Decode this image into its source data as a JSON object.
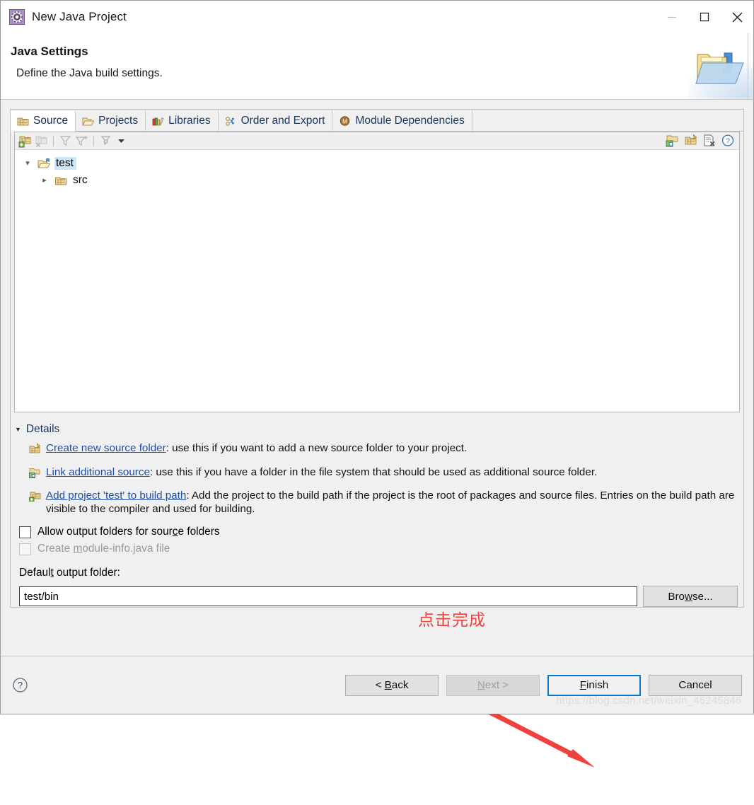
{
  "window": {
    "title": "New Java Project",
    "icon": "java-project-icon",
    "controls": {
      "minimize": "minimize-icon",
      "maximize": "maximize-icon",
      "close": "close-icon"
    }
  },
  "header": {
    "title": "Java Settings",
    "subtitle": "Define the Java build settings.",
    "banner_icon": "java-folder-banner-icon"
  },
  "tabs": [
    {
      "label": "Source",
      "icon": "source-folder-icon",
      "active": true
    },
    {
      "label": "Projects",
      "icon": "open-folder-icon",
      "active": false
    },
    {
      "label": "Libraries",
      "icon": "library-books-icon",
      "active": false
    },
    {
      "label": "Order and Export",
      "icon": "order-export-icon",
      "active": false
    },
    {
      "label": "Module Dependencies",
      "icon": "module-icon",
      "active": false
    }
  ],
  "tree_toolbar": {
    "left_icons": [
      "add-source-folder-icon",
      "remove-source-folder-icon",
      "filter-icon",
      "add-filter-icon",
      "collapse-icon",
      "dropdown-arrow-icon"
    ],
    "right_icons": [
      "link-source-icon",
      "new-folder-icon",
      "remove-entry-icon",
      "help-icon"
    ]
  },
  "tree": {
    "nodes": [
      {
        "label": "test",
        "icon": "project-folder-icon",
        "expanded": true,
        "selected": true,
        "level": 0
      },
      {
        "label": "src",
        "icon": "source-package-icon",
        "expanded": false,
        "selected": false,
        "level": 1
      }
    ]
  },
  "details": {
    "section_label": "Details",
    "expanded": true,
    "items": [
      {
        "icon": "create-source-folder-icon",
        "link": "Create new source folder",
        "rest": ": use this if you want to add a new source folder to your project."
      },
      {
        "icon": "link-source-icon",
        "link": "Link additional source",
        "rest": ": use this if you have a folder in the file system that should be used as additional source folder."
      },
      {
        "icon": "add-project-build-path-icon",
        "link": "Add project 'test' to build path",
        "rest": ": Add the project to the build path if the project is the root of packages and source files. Entries on the build path are visible to the compiler and used for building."
      }
    ]
  },
  "options": {
    "allow_output_folders": {
      "label_pre": "Allow output folders for sour",
      "label_mnemonic": "c",
      "label_post": "e folders",
      "checked": false,
      "enabled": true
    },
    "create_module_info": {
      "label_pre": "Create ",
      "label_mnemonic": "m",
      "label_post": "odule-info.java file",
      "checked": false,
      "enabled": false
    }
  },
  "output_folder": {
    "label_pre": "Defaul",
    "label_mnemonic": "t",
    "label_post": " output folder:",
    "value": "test/bin",
    "browse_pre": "Bro",
    "browse_mnemonic": "w",
    "browse_post": "se..."
  },
  "annotation": {
    "text": "点击完成",
    "color": "#f0413c",
    "arrow": "red-arrow-pointing-to-finish"
  },
  "footer": {
    "help_icon": "help-question-icon",
    "buttons": [
      {
        "name": "back",
        "pre": "< ",
        "mnemonic": "B",
        "post": "ack",
        "state": "enabled"
      },
      {
        "name": "next",
        "pre": "",
        "mnemonic": "N",
        "post": "ext >",
        "state": "disabled"
      },
      {
        "name": "finish",
        "pre": "",
        "mnemonic": "F",
        "post": "inish",
        "state": "focused"
      },
      {
        "name": "cancel",
        "pre": "",
        "mnemonic": "",
        "post": "Cancel",
        "state": "enabled"
      }
    ]
  },
  "watermark": "https://blog.csdn.net/weixin_46245846"
}
